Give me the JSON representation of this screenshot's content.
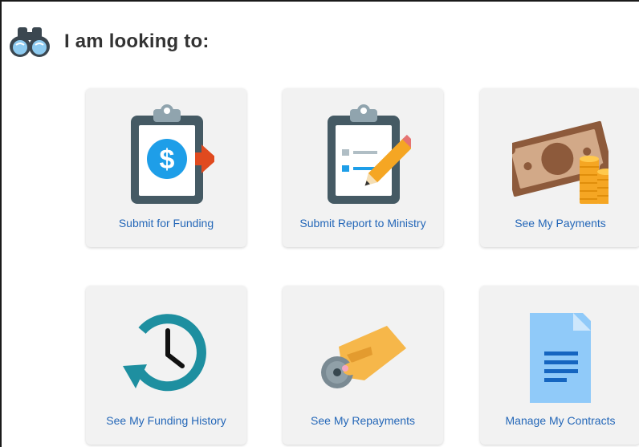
{
  "header": {
    "title": "I am looking to:",
    "icon": "binoculars-icon"
  },
  "tiles": [
    {
      "label": "Submit for Funding",
      "icon": "clipboard-dollar-arrow-icon"
    },
    {
      "label": "Submit Report to Ministry",
      "icon": "clipboard-pencil-icon"
    },
    {
      "label": "See My Payments",
      "icon": "money-coins-icon"
    },
    {
      "label": "See My Funding History",
      "icon": "history-clock-icon"
    },
    {
      "label": "See My Repayments",
      "icon": "hand-coin-icon"
    },
    {
      "label": "Manage My Contracts",
      "icon": "document-icon"
    }
  ],
  "colors": {
    "link": "#2467b8",
    "heading": "#333333",
    "tile_bg": "#f2f2f2",
    "clipboard_dark": "#455a64",
    "accent_blue": "#1e9ee8",
    "arrow_red": "#e04a1f",
    "teal": "#1e8fa0",
    "doc_blue": "#90caf9"
  }
}
